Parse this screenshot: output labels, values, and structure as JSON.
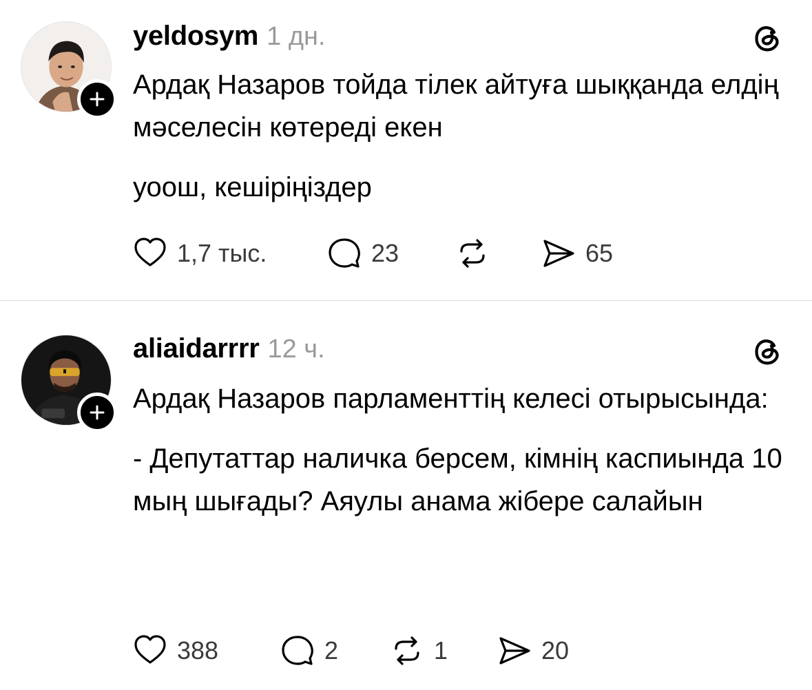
{
  "posts": [
    {
      "username": "yeldosym",
      "time": "1 дн.",
      "paragraphs": [
        "Ардақ Назаров тойда тілек айтуға шыққанда елдің мәселесін көтереді екен",
        "уоош, кешіріңіздер"
      ],
      "likes": "1,7 тыс.",
      "replies": "23",
      "reposts": "",
      "shares": "65"
    },
    {
      "username": "aliaidarrrr",
      "time": "12 ч.",
      "paragraphs": [
        "Ардақ Назаров парламенттің келесі отырысында:",
        "- Депутаттар наличка берсем, кімнің каспиында 10 мың шығады? Аяулы анама жібере салайын"
      ],
      "likes": "388",
      "replies": "2",
      "reposts": "1",
      "shares": "20"
    }
  ],
  "icons": {
    "like": "heart-icon",
    "reply": "speech-bubble-icon",
    "repost": "repost-arrows-icon",
    "share": "paper-plane-icon",
    "app": "threads-logo-icon",
    "follow": "plus-icon"
  },
  "colors": {
    "text": "#000000",
    "muted": "#9a9a9a",
    "count": "#3a3a3a",
    "divider": "#dcdcdc"
  }
}
